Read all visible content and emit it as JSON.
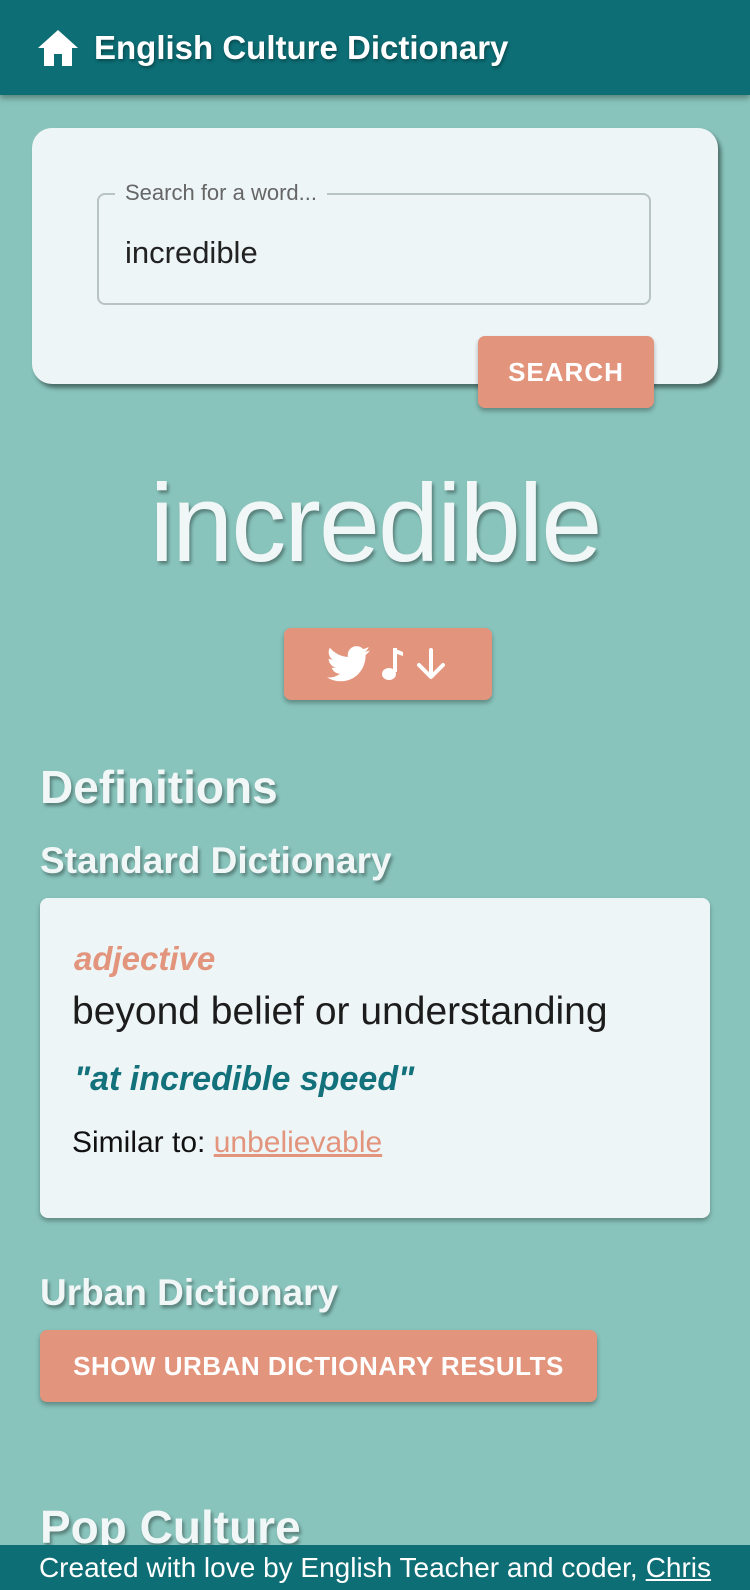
{
  "appbar": {
    "title": "English Culture Dictionary",
    "icon": "home-icon"
  },
  "search": {
    "placeholder": "Search for a word...",
    "value": "incredible",
    "button_label": "SEARCH"
  },
  "word": {
    "title": "incredible",
    "actions": [
      {
        "icon": "twitter-icon"
      },
      {
        "icon": "music-note-icon"
      },
      {
        "icon": "arrow-down-icon"
      }
    ]
  },
  "definitions": {
    "heading": "Definitions",
    "standard_heading": "Standard Dictionary",
    "entry": {
      "part_of_speech": "adjective",
      "meaning": "beyond belief or understanding",
      "example": "\"at incredible speed\"",
      "similar_label": "Similar to:",
      "similar_word": "unbelievable"
    },
    "urban_heading": "Urban Dictionary",
    "urban_button_label": "SHOW URBAN DICTIONARY RESULTS"
  },
  "pop_culture": {
    "heading": "Pop Culture"
  },
  "footer": {
    "text": "Created with love by English Teacher and coder,",
    "link": "Chris"
  },
  "colors": {
    "background": "#88c4bc",
    "primary": "#0d6e75",
    "accent": "#e2947c",
    "card": "#eef5f7"
  }
}
